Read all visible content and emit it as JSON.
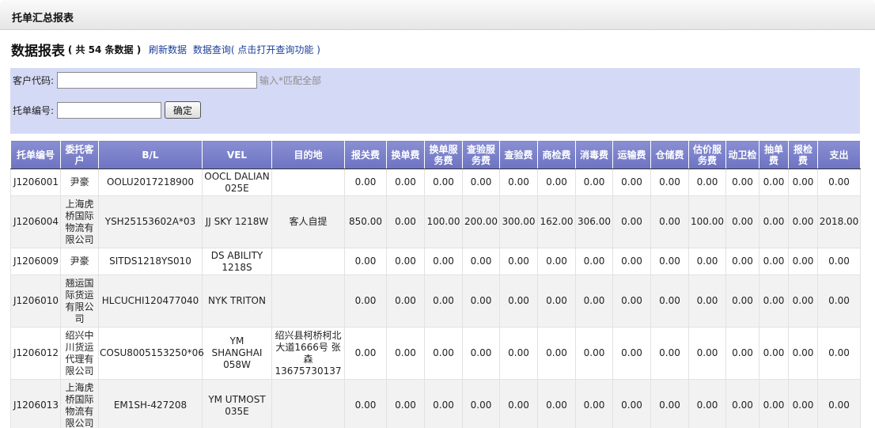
{
  "window": {
    "title": "托单汇总报表"
  },
  "heading": {
    "title": "数据报表",
    "count_text": "( 共 54 条数据 )",
    "refresh_link": "刷新数据",
    "query_link": "数据查询( 点击打开查询功能 )"
  },
  "query": {
    "customer_label": "客户代码:",
    "customer_value": "",
    "customer_hint": "输入*匹配全部",
    "order_label": "托单编号:",
    "order_value": "",
    "confirm_label": "确定"
  },
  "table": {
    "columns": [
      "托单编号",
      "委托客户",
      "B/L",
      "VEL",
      "目的地",
      "报关费",
      "换单费",
      "换单服务费",
      "查验服务费",
      "查验费",
      "商检费",
      "消毒费",
      "运输费",
      "仓储费",
      "估价服务费",
      "动卫检",
      "抽单费",
      "报检费",
      "支出"
    ],
    "rows": [
      [
        "J1206001",
        "尹豪",
        "OOLU2017218900",
        "OOCL DALIAN 025E",
        "",
        "0.00",
        "0.00",
        "0.00",
        "0.00",
        "0.00",
        "0.00",
        "0.00",
        "0.00",
        "0.00",
        "0.00",
        "0.00",
        "0.00",
        "0.00",
        "0.00"
      ],
      [
        "J1206004",
        "上海虎桥国际物流有限公司",
        "YSH25153602A*03",
        "JJ SKY 1218W",
        "客人自提",
        "850.00",
        "0.00",
        "100.00",
        "200.00",
        "300.00",
        "162.00",
        "306.00",
        "0.00",
        "0.00",
        "100.00",
        "0.00",
        "0.00",
        "0.00",
        "2018.00"
      ],
      [
        "J1206009",
        "尹豪",
        "SITDS1218YS010",
        "DS ABILITY 1218S",
        "",
        "0.00",
        "0.00",
        "0.00",
        "0.00",
        "0.00",
        "0.00",
        "0.00",
        "0.00",
        "0.00",
        "0.00",
        "0.00",
        "0.00",
        "0.00",
        "0.00"
      ],
      [
        "J1206010",
        "翘运国际货运有限公司",
        "HLCUCHI120477040",
        "NYK TRITON",
        "",
        "0.00",
        "0.00",
        "0.00",
        "0.00",
        "0.00",
        "0.00",
        "0.00",
        "0.00",
        "0.00",
        "0.00",
        "0.00",
        "0.00",
        "0.00",
        "0.00"
      ],
      [
        "J1206012",
        "绍兴中川货运代理有限公司",
        "COSU8005153250*06",
        "YM SHANGHAI 058W",
        "绍兴县柯桥柯北大道1666号 张森 13675730137",
        "0.00",
        "0.00",
        "0.00",
        "0.00",
        "0.00",
        "0.00",
        "0.00",
        "0.00",
        "0.00",
        "0.00",
        "0.00",
        "0.00",
        "0.00",
        "0.00"
      ],
      [
        "J1206013",
        "上海虎桥国际物流有限公司",
        "EM1SH-427208",
        "YM UTMOST 035E",
        "",
        "0.00",
        "0.00",
        "0.00",
        "0.00",
        "0.00",
        "0.00",
        "0.00",
        "0.00",
        "0.00",
        "0.00",
        "0.00",
        "0.00",
        "0.00",
        "0.00"
      ]
    ]
  }
}
